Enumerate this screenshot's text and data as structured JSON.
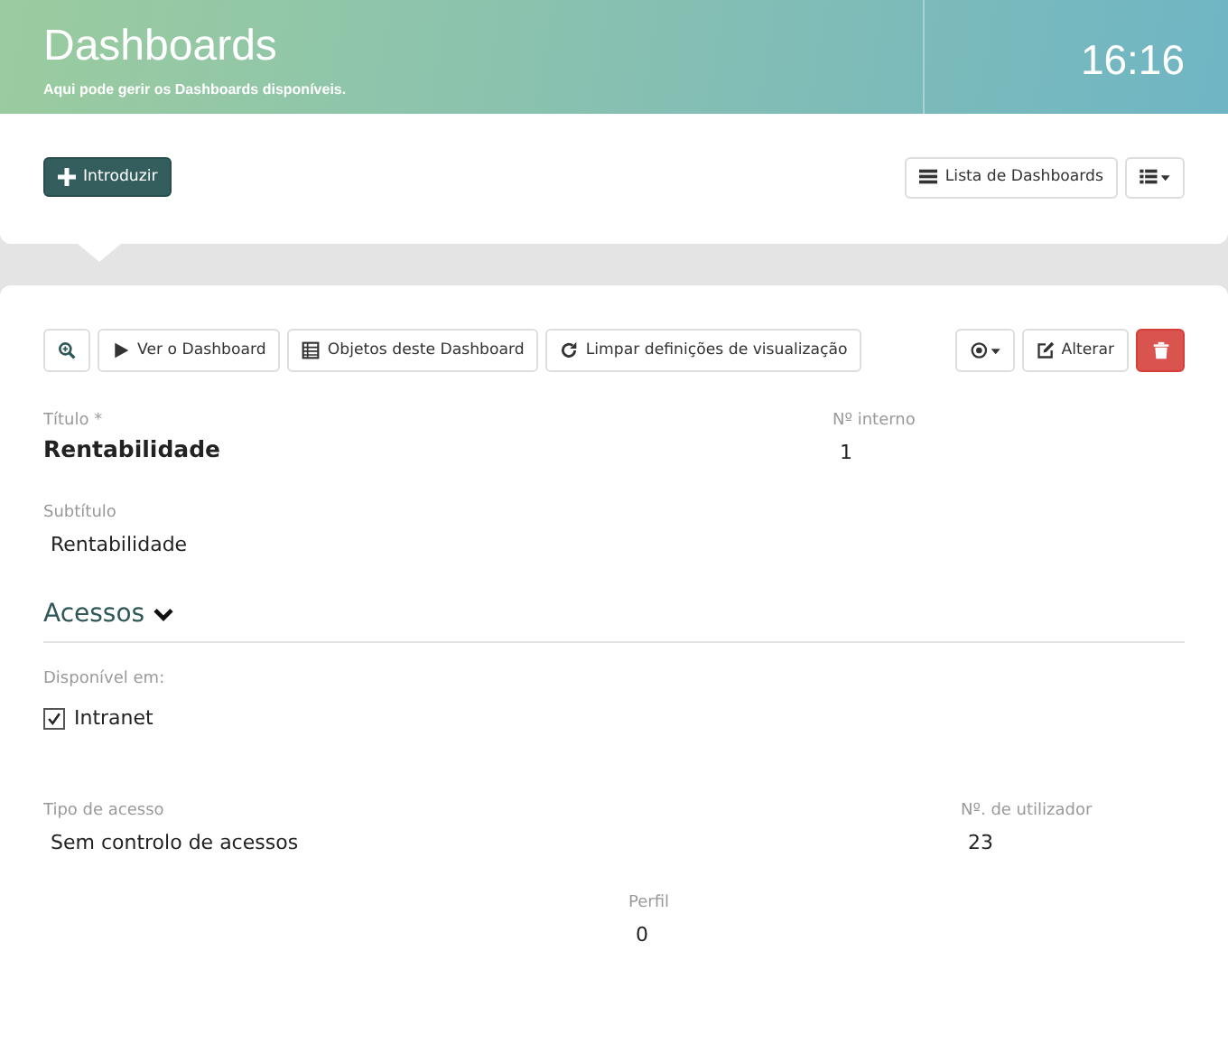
{
  "header": {
    "title": "Dashboards",
    "subtitle": "Aqui pode gerir os Dashboards disponíveis.",
    "clock": "16:16"
  },
  "top_toolbar": {
    "primary": {
      "label": "Introduzir"
    },
    "right": [
      {
        "label": "Lista de Dashboards"
      }
    ]
  },
  "record_toolbar": {
    "left": [
      {
        "label": "Ver o Dashboard"
      },
      {
        "label": "Objetos deste Dashboard"
      },
      {
        "label": "Limpar definições de visualização"
      }
    ],
    "right": [
      {
        "kind": "default"
      },
      {
        "label": "Alterar",
        "kind": "default"
      },
      {
        "kind": "danger"
      }
    ]
  },
  "fields": {
    "title": {
      "label": "Título *",
      "value": "Rentabilidade"
    },
    "internal_number": {
      "label": "Nº interno",
      "value": "1"
    },
    "subtitle": {
      "label": "Subtítulo",
      "value": "Rentabilidade"
    }
  },
  "section": {
    "title": "Acessos",
    "expanded": true,
    "available_label": "Disponível em:",
    "options": [
      {
        "label": "Intranet",
        "checked": true
      }
    ],
    "access_type": {
      "label": "Tipo de acesso",
      "value": "Sem controlo de acessos"
    },
    "user_number": {
      "label": "Nº. de utilizador",
      "value": "23"
    },
    "profile": {
      "label": "Perfil",
      "value": "0"
    }
  }
}
